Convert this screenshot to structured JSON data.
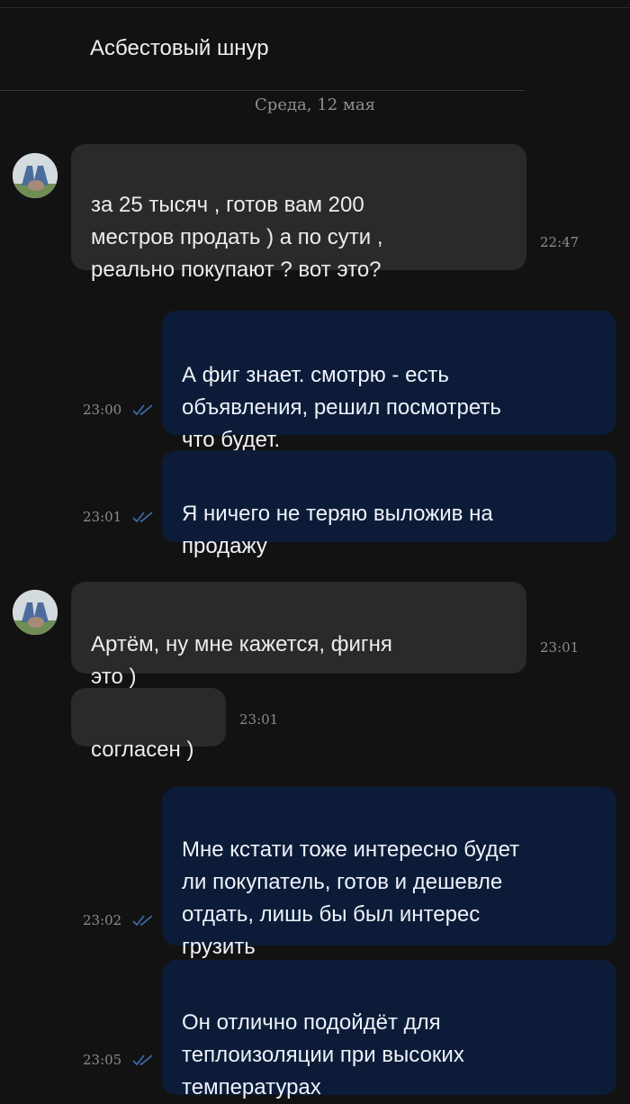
{
  "chat": {
    "title": "Асбестовый шнур",
    "date_separator": "Среда, 12 мая"
  },
  "messages": [
    {
      "dir": "in",
      "avatar": true,
      "text": "за 25 тысяч  , готов вам 200\nместров  продать )  а по сути  ,\nреально покупают ? вот это?",
      "time": "22:47"
    },
    {
      "dir": "out",
      "text": "А фиг знает. смотрю - есть\nобъявления, решил посмотреть\nчто будет.",
      "time": "23:00",
      "status": "read-icon"
    },
    {
      "dir": "out",
      "text": "Я ничего не теряю выложив на\nпродажу",
      "time": "23:01",
      "status": "read-icon"
    },
    {
      "dir": "in",
      "avatar": true,
      "text": "Артём,  ну мне кажется,  фигня\nэто )",
      "time": "23:01"
    },
    {
      "dir": "in",
      "avatar": false,
      "text": "согласен )",
      "time": "23:01"
    },
    {
      "dir": "out",
      "text": "Мне кстати тоже интересно будет\nли покупатель, готов и дешевле\nотдать, лишь бы был интерес\nгрузить",
      "time": "23:02",
      "status": "read-icon"
    },
    {
      "dir": "out",
      "text": "Он отлично подойдёт для\nтеплоизоляции при высоких\nтемпературах",
      "time": "23:05",
      "status": "read-icon"
    }
  ],
  "colors": {
    "background": "#121212",
    "incoming_bubble": "#2a2a2c",
    "outgoing_bubble": "#0c1c38",
    "read_ticks": "#3f6fb0"
  }
}
